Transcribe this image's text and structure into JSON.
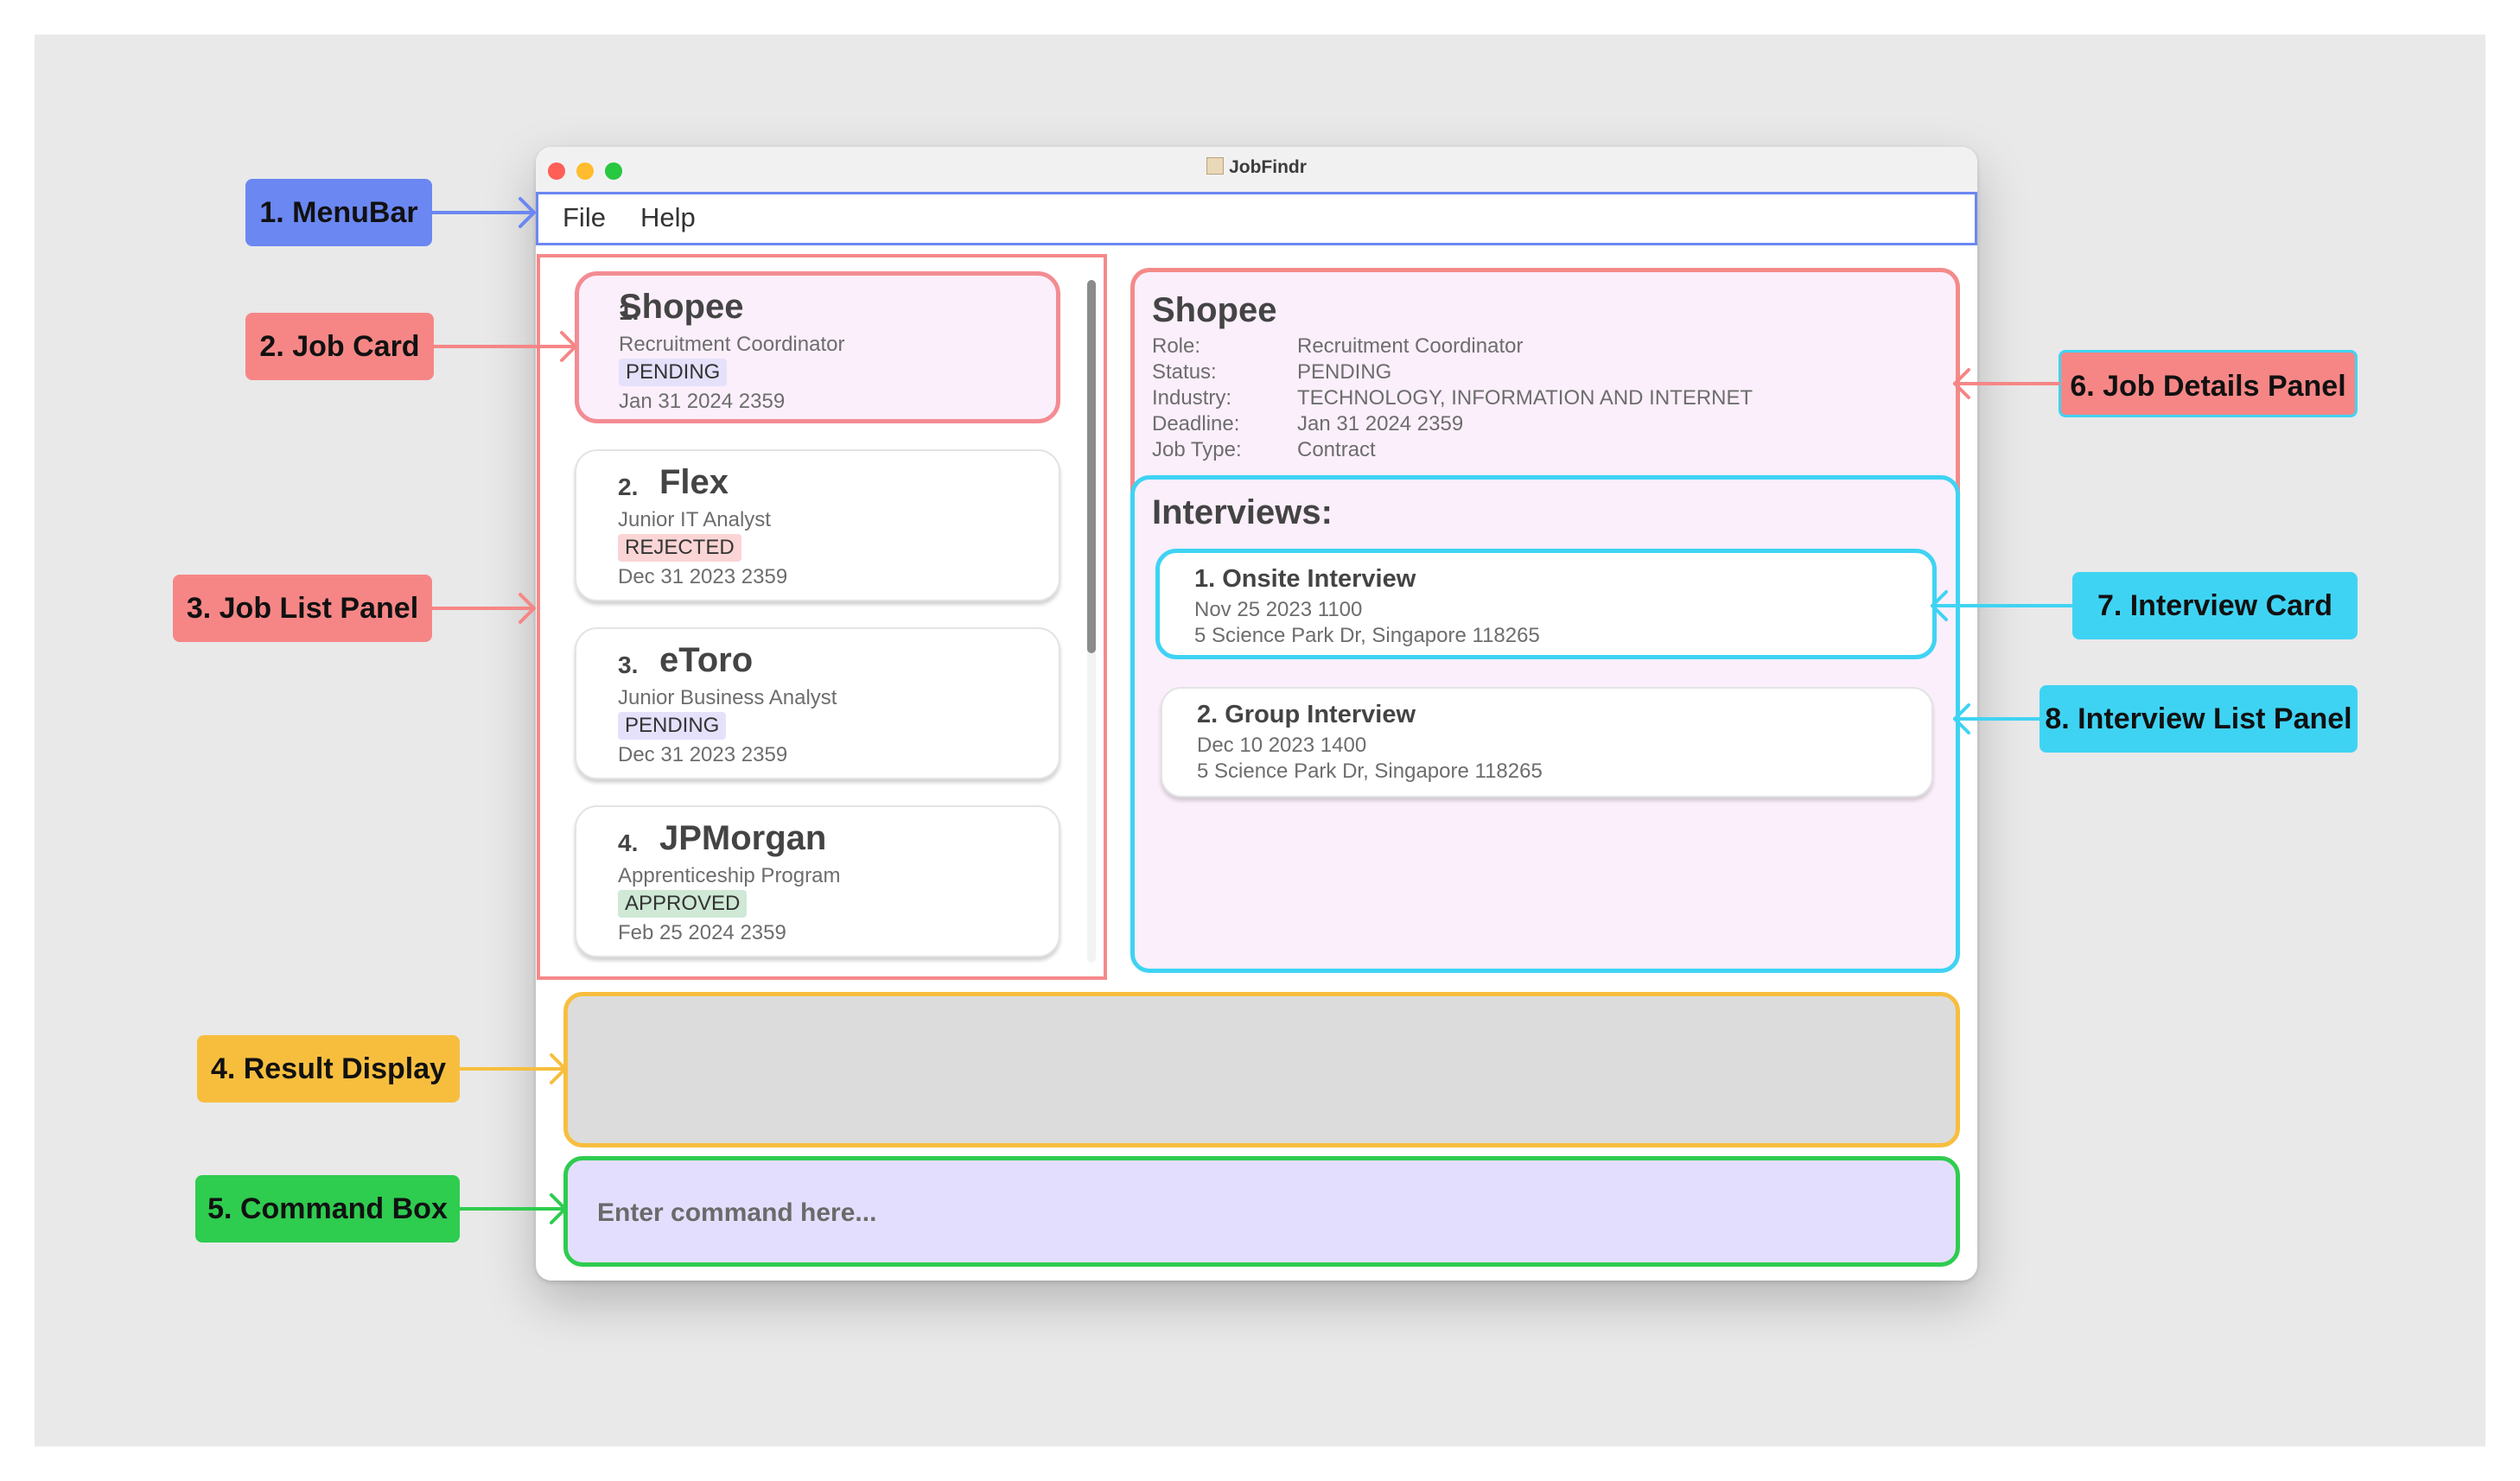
{
  "window": {
    "title": "JobFindr"
  },
  "menubar": {
    "items": [
      "File",
      "Help"
    ]
  },
  "jobs": [
    {
      "index": "1.",
      "company": "Shopee",
      "role": "Recruitment Coordinator",
      "status": "PENDING",
      "deadline": "Jan 31 2024 2359",
      "status_color": "#e6e1fb"
    },
    {
      "index": "2.",
      "company": "Flex",
      "role": "Junior IT Analyst",
      "status": "REJECTED",
      "deadline": "Dec 31 2023 2359",
      "status_color": "#fbd5d5"
    },
    {
      "index": "3.",
      "company": "eToro",
      "role": "Junior Business Analyst",
      "status": "PENDING",
      "deadline": "Dec 31 2023 2359",
      "status_color": "#e6e1fb"
    },
    {
      "index": "4.",
      "company": "JPMorgan",
      "role": "Apprenticeship Program",
      "status": "APPROVED",
      "deadline": "Feb 25 2024 2359",
      "status_color": "#cfe9d6"
    }
  ],
  "details": {
    "company": "Shopee",
    "fields": [
      {
        "label": "Role:",
        "value": "Recruitment Coordinator"
      },
      {
        "label": "Status:",
        "value": "PENDING"
      },
      {
        "label": "Industry:",
        "value": "TECHNOLOGY, INFORMATION AND INTERNET"
      },
      {
        "label": "Deadline:",
        "value": "Jan 31 2024 2359"
      },
      {
        "label": "Job Type:",
        "value": "Contract"
      }
    ]
  },
  "interviews": {
    "heading": "Interviews:",
    "items": [
      {
        "title": "1. Onsite Interview",
        "datetime": "Nov 25 2023 1100",
        "location": "5 Science Park Dr, Singapore 118265"
      },
      {
        "title": "2. Group Interview",
        "datetime": "Dec 10 2023 1400",
        "location": "5 Science Park Dr, Singapore 118265"
      }
    ]
  },
  "result_display": {
    "text": ""
  },
  "command_box": {
    "placeholder": "Enter command here..."
  },
  "annotations": [
    {
      "text": "1. MenuBar",
      "color": "#6b87f2"
    },
    {
      "text": "2. Job Card",
      "color": "#f68686"
    },
    {
      "text": "3. Job List Panel",
      "color": "#f68686"
    },
    {
      "text": "4. Result Display",
      "color": "#f7be3e"
    },
    {
      "text": "5. Command Box",
      "color": "#2ecc4f"
    },
    {
      "text": "6. Job Details Panel",
      "color": "#f68686"
    },
    {
      "text": "7. Interview Card",
      "color": "#3fd3f3"
    },
    {
      "text": "8. Interview List Panel",
      "color": "#3fd3f3"
    }
  ]
}
